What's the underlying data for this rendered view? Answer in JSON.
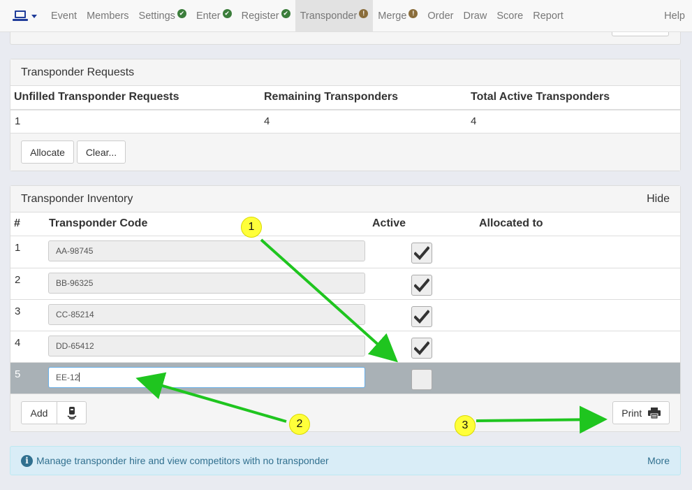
{
  "nav": {
    "items": [
      {
        "label": "Event",
        "badge": ""
      },
      {
        "label": "Members",
        "badge": ""
      },
      {
        "label": "Settings",
        "badge": "ok"
      },
      {
        "label": "Enter",
        "badge": "ok"
      },
      {
        "label": "Register",
        "badge": "ok"
      },
      {
        "label": "Transponder",
        "badge": "warn",
        "active": true
      },
      {
        "label": "Merge",
        "badge": "warn"
      },
      {
        "label": "Order",
        "badge": ""
      },
      {
        "label": "Draw",
        "badge": ""
      },
      {
        "label": "Score",
        "badge": ""
      },
      {
        "label": "Report",
        "badge": ""
      }
    ],
    "help": "Help",
    "brand_icon": "laptop-icon",
    "brand_color": "#1f3c99"
  },
  "requests": {
    "title": "Transponder Requests",
    "columns": [
      "Unfilled Transponder Requests",
      "Remaining Transponders",
      "Total Active Transponders"
    ],
    "values": [
      "1",
      "4",
      "4"
    ],
    "allocate_label": "Allocate",
    "clear_label": "Clear..."
  },
  "inventory": {
    "title": "Transponder Inventory",
    "hide_label": "Hide",
    "columns": {
      "num": "#",
      "code": "Transponder Code",
      "active": "Active",
      "allocated": "Allocated to"
    },
    "rows": [
      {
        "num": "1",
        "code": "AA-98745",
        "active": true,
        "allocated": ""
      },
      {
        "num": "2",
        "code": "BB-96325",
        "active": true,
        "allocated": ""
      },
      {
        "num": "3",
        "code": "CC-85214",
        "active": true,
        "allocated": ""
      },
      {
        "num": "4",
        "code": "DD-65412",
        "active": true,
        "allocated": ""
      },
      {
        "num": "5",
        "code": "EE-12",
        "active": false,
        "allocated": "",
        "editing": true
      }
    ],
    "add_label": "Add",
    "print_label": "Print"
  },
  "info": {
    "text": "Manage transponder hire and view competitors with no transponder",
    "more_label": "More",
    "icon_glyph": "i"
  },
  "callouts": [
    "1",
    "2",
    "3"
  ],
  "colors": {
    "annotation_arrow": "#1fc51f",
    "callout_fill": "#ffff3a",
    "selected_row": "#a9b1b6"
  }
}
